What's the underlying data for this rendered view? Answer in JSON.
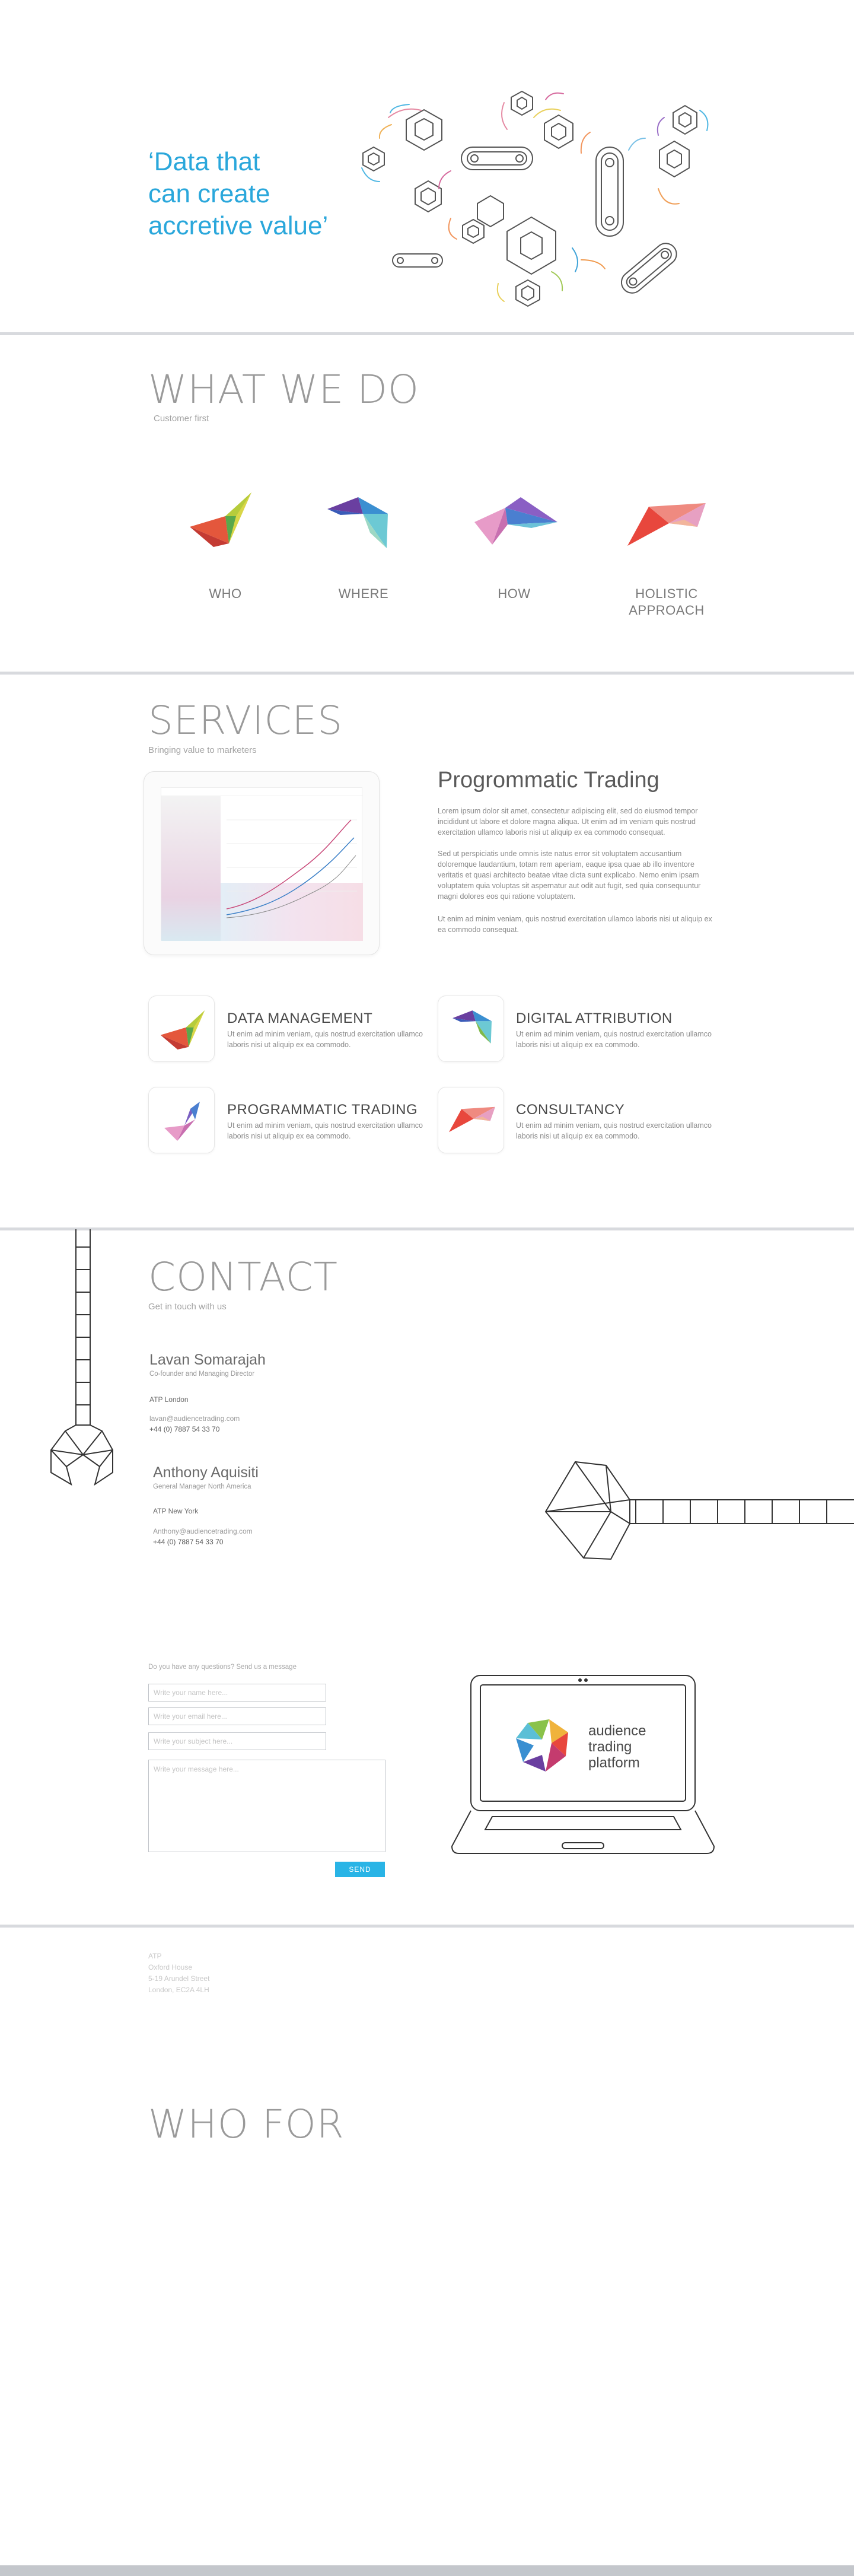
{
  "hero": {
    "quote_line1": "‘Data that",
    "quote_line2": "can create",
    "quote_line3": "accretive value’",
    "accent_color": "#2aa7db"
  },
  "what_we_do": {
    "title": "WHAT WE DO",
    "subtitle": "Customer first",
    "items": [
      {
        "line1": "WHO",
        "line2": ""
      },
      {
        "line1": "WHERE",
        "line2": ""
      },
      {
        "line1": "HOW",
        "line2": ""
      },
      {
        "line1": "HOLISTIC",
        "line2": "APPROACH"
      }
    ]
  },
  "services": {
    "title": "SERVICES",
    "subtitle": "Bringing value to marketers",
    "feature": {
      "title": "Progrommatic Trading",
      "para1": "Lorem ipsum dolor sit amet, consectetur adipiscing elit, sed do eiusmod tempor incididunt ut labore et dolore magna aliqua. Ut enim ad  im veniam      quis nostrud exercitation ullamco laboris nisi ut aliquip ex ea commodo consequat.",
      "para2": "Sed ut perspiciatis unde omnis iste natus error sit voluptatem accusantium doloremque laudantium, totam rem aperiam, eaque ipsa quae ab illo inventore veritatis et quasi architecto beatae vitae dicta sunt explicabo. Nemo enim ipsam voluptatem quia voluptas sit aspernatur aut odit aut fugit, sed quia consequuntur magni dolores eos qui ratione voluptatem.",
      "para3": "Ut enim ad minim veniam, quis nostrud exercitation ullamco laboris nisi ut aliquip ex ea commodo consequat."
    },
    "cards": [
      {
        "title": "DATA MANAGEMENT",
        "text": "Ut enim ad minim veniam, quis nostrud exercitation ullamco laboris nisi ut aliquip ex ea commodo."
      },
      {
        "title": "DIGITAL ATTRIBUTION",
        "text": "Ut enim ad minim veniam, quis nostrud exercitation ullamco laboris nisi ut aliquip ex ea commodo."
      },
      {
        "title": "PROGRAMMATIC TRADING",
        "text": "Ut enim ad minim veniam, quis nostrud exercitation ullamco laboris nisi ut aliquip ex ea commodo."
      },
      {
        "title": "CONSULTANCY",
        "text": "Ut enim ad minim veniam, quis nostrud exercitation ullamco laboris nisi ut aliquip ex ea commodo."
      }
    ]
  },
  "contact": {
    "title": "CONTACT",
    "subtitle": "Get in touch with us",
    "people": [
      {
        "name": "Lavan Somarajah",
        "role": "Co-founder and Managing Director",
        "office": "ATP London",
        "email": "lavan@audiencetrading.com",
        "phone": "+44 (0) 7887 54 33 70"
      },
      {
        "name": "Anthony Aquisiti",
        "role": "General Manager North America",
        "office": "ATP New York",
        "email": "Anthony@audiencetrading.com",
        "phone": "+44 (0) 7887 54 33 70"
      }
    ],
    "form": {
      "prompt": "Do you have any questions? Send us a message",
      "name_placeholder": "Write your name here...",
      "email_placeholder": "Write your email here...",
      "subject_placeholder": "Write your subject here...",
      "message_placeholder": "Write your message here...",
      "send_label": "SEND"
    },
    "laptop_brand": {
      "line1": "audience",
      "line2": "trading",
      "line3": "platform"
    }
  },
  "footer": {
    "line1": "ATP",
    "line2": "Oxford House",
    "line3": "5-19 Arundel Street",
    "line4": "London, EC2A 4LH"
  },
  "who_for": {
    "title": "WHO FOR"
  }
}
